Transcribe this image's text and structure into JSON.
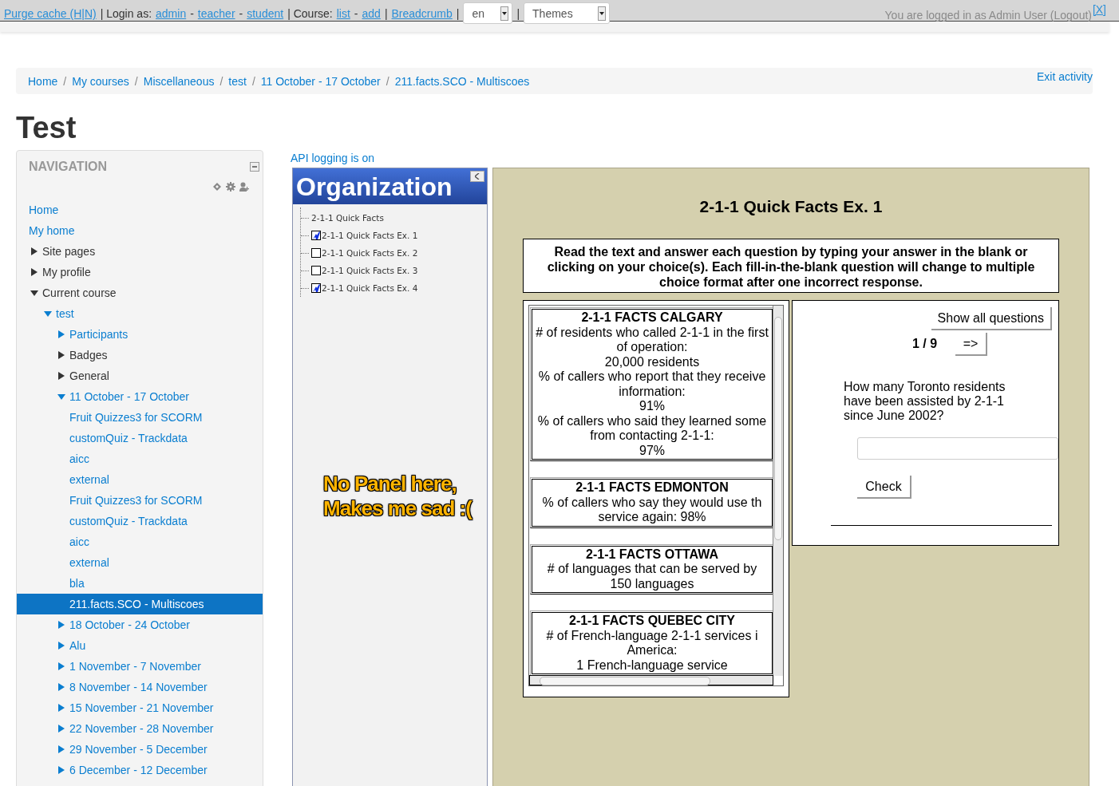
{
  "top_bar": {
    "items": [
      {
        "kind": "link",
        "text": "Purge cache (H|N)"
      },
      {
        "kind": "text",
        "text": "| Login as:"
      },
      {
        "kind": "link",
        "text": "admin"
      },
      {
        "kind": "text",
        "text": "-"
      },
      {
        "kind": "link",
        "text": "teacher"
      },
      {
        "kind": "text",
        "text": "-"
      },
      {
        "kind": "link",
        "text": "student"
      },
      {
        "kind": "text",
        "text": "| Course:"
      },
      {
        "kind": "link",
        "text": "list"
      },
      {
        "kind": "text",
        "text": "-"
      },
      {
        "kind": "link",
        "text": "add"
      },
      {
        "kind": "text",
        "text": "|"
      },
      {
        "kind": "link",
        "text": "Breadcrumb"
      },
      {
        "kind": "text",
        "text": "|"
      },
      {
        "kind": "select",
        "text": "en"
      },
      {
        "kind": "text",
        "text": "|"
      },
      {
        "kind": "select",
        "text": "Themes"
      }
    ],
    "login_info": "You are logged in as Admin User (Logout)",
    "close": "[X]"
  },
  "breadcrumb": {
    "items": [
      "Home",
      "My courses",
      "Miscellaneous",
      "test",
      "11 October - 17 October",
      "211.facts.SCO - Multiscoes"
    ],
    "separator": "/",
    "exit": "Exit activity"
  },
  "page_title": "Test",
  "navigation": {
    "title": "NAVIGATION",
    "items": [
      {
        "label": "Home",
        "kind": "link",
        "selected": false
      },
      {
        "label": "My home",
        "kind": "link",
        "selected": false
      },
      {
        "label": "Site pages",
        "kind": "text",
        "expanded": false,
        "selected": false
      },
      {
        "label": "My profile",
        "kind": "text",
        "expanded": false,
        "selected": false
      },
      {
        "label": "Current course",
        "kind": "text",
        "expanded": true,
        "selected": false,
        "children": [
          {
            "label": "test",
            "kind": "link",
            "expanded": true,
            "selected": false,
            "children": [
              {
                "label": "Participants",
                "kind": "link",
                "expanded": false,
                "selected": false
              },
              {
                "label": "Badges",
                "kind": "text",
                "expanded": false,
                "selected": false
              },
              {
                "label": "General",
                "kind": "text",
                "expanded": false,
                "selected": false
              },
              {
                "label": "11 October - 17 October",
                "kind": "link",
                "expanded": true,
                "selected": false,
                "children": [
                  {
                    "label": "Fruit Quizzes3 for SCORM",
                    "kind": "link",
                    "selected": false
                  },
                  {
                    "label": "customQuiz - Trackdata",
                    "kind": "link",
                    "selected": false
                  },
                  {
                    "label": "aicc",
                    "kind": "link",
                    "selected": false
                  },
                  {
                    "label": "external",
                    "kind": "link",
                    "selected": false
                  },
                  {
                    "label": "Fruit Quizzes3 for SCORM",
                    "kind": "link",
                    "selected": false
                  },
                  {
                    "label": "customQuiz - Trackdata",
                    "kind": "link",
                    "selected": false
                  },
                  {
                    "label": "aicc",
                    "kind": "link",
                    "selected": false
                  },
                  {
                    "label": "external",
                    "kind": "link",
                    "selected": false
                  },
                  {
                    "label": "bla",
                    "kind": "link",
                    "selected": false
                  },
                  {
                    "label": "211.facts.SCO - Multiscoes",
                    "kind": "link",
                    "selected": true
                  }
                ]
              },
              {
                "label": "18 October - 24 October",
                "kind": "link",
                "expanded": false,
                "selected": false
              },
              {
                "label": "Alu",
                "kind": "link",
                "expanded": false,
                "selected": false
              },
              {
                "label": "1 November - 7 November",
                "kind": "link",
                "expanded": false,
                "selected": false
              },
              {
                "label": "8 November - 14 November",
                "kind": "link",
                "expanded": false,
                "selected": false
              },
              {
                "label": "15 November - 21 November",
                "kind": "link",
                "expanded": false,
                "selected": false
              },
              {
                "label": "22 November - 28 November",
                "kind": "link",
                "expanded": false,
                "selected": false
              },
              {
                "label": "29 November - 5 December",
                "kind": "link",
                "expanded": false,
                "selected": false
              },
              {
                "label": "6 December - 12 December",
                "kind": "link",
                "expanded": false,
                "selected": false
              }
            ]
          }
        ]
      }
    ]
  },
  "api_status": "API logging is on",
  "organization": {
    "title": "Organization",
    "items": [
      {
        "label": "2-1-1 Quick Facts"
      },
      {
        "label": "2-1-1 Quick Facts Ex. 1",
        "checked": true
      },
      {
        "label": "2-1-1 Quick Facts Ex. 2",
        "checked": false
      },
      {
        "label": "2-1-1 Quick Facts Ex. 3",
        "checked": false
      },
      {
        "label": "2-1-1 Quick Facts Ex. 4",
        "checked": true
      }
    ],
    "overlay_caption": [
      "No Panel here,",
      "Makes me sad :("
    ]
  },
  "quiz": {
    "title": "2-1-1 Quick Facts Ex. 1",
    "instructions": "Read the text and answer each question by typing your answer in the blank or clicking on your choice(s). Each fill-in-the-blank question will change to multiple choice format after one incorrect response.",
    "facts": [
      {
        "title": "2-1-1 FACTS CALGARY",
        "lines": [
          "# of residents who called 2-1-1 in the first",
          "of operation:",
          "20,000 residents",
          "% of callers who report that they receive",
          "information:",
          "91%",
          "% of callers who said they learned some",
          "from contacting 2-1-1:",
          "97%"
        ]
      },
      {
        "title": "2-1-1 FACTS EDMONTON",
        "lines": [
          "% of callers who say they would use th",
          "service again: 98%"
        ]
      },
      {
        "title": "2-1-1 FACTS OTTAWA",
        "lines": [
          "# of languages that can be served by",
          "150 languages"
        ]
      },
      {
        "title": "2-1-1 FACTS QUEBEC CITY",
        "lines": [
          "# of French-language 2-1-1 services i",
          "America:",
          "1 French-language service"
        ]
      }
    ],
    "show_all": "Show all questions",
    "counter": "1 / 9",
    "next": "=>",
    "question": "How many Toronto residents have been assisted by 2-1-1 since June 2002?",
    "check": "Check"
  }
}
